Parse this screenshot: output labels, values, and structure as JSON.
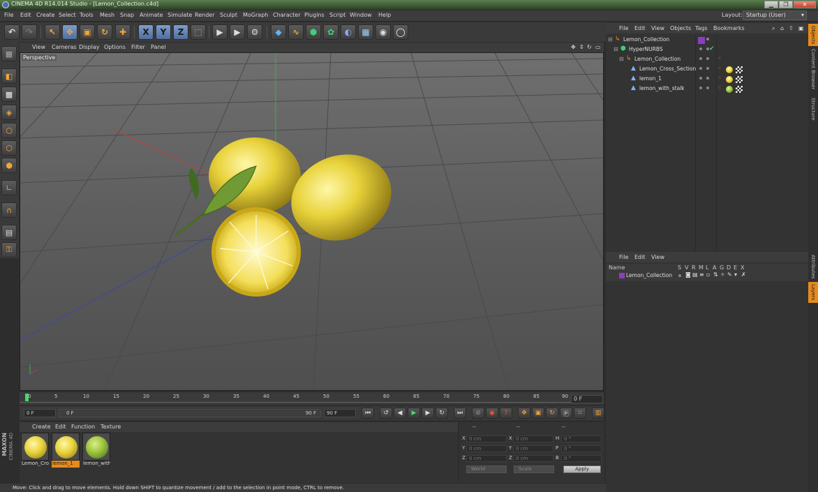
{
  "window": {
    "title": "CINEMA 4D R14.014 Studio - [Lemon_Collection.c4d]",
    "minimize": "▁",
    "maximize": "❐",
    "close": "✕"
  },
  "menubar": {
    "items": [
      "File",
      "Edit",
      "Create",
      "Select",
      "Tools",
      "Mesh",
      "Snap",
      "Animate",
      "Simulate",
      "Render",
      "Sculpt",
      "MoGraph",
      "Character",
      "Plugins",
      "Script",
      "Window",
      "Help"
    ],
    "layout_label": "Layout:",
    "layout_value": "Startup (User)"
  },
  "toolbar": {
    "icons": [
      "undo-icon",
      "redo-icon",
      "live-selection-icon",
      "move-icon",
      "scale-icon",
      "rotate-icon",
      "add-icon",
      "x-axis-icon",
      "y-axis-icon",
      "z-axis-icon",
      "coord-system-icon",
      "render-view-icon",
      "render-picture-viewer-icon",
      "render-settings-icon",
      "cube-icon",
      "spline-icon",
      "nurbs-icon",
      "array-icon",
      "deformer-icon",
      "floor-icon",
      "camera-icon",
      "light-icon"
    ],
    "x_label": "X",
    "y_label": "Y",
    "z_label": "Z"
  },
  "viewport": {
    "menu": [
      "View",
      "Cameras",
      "Display",
      "Options",
      "Filter",
      "Panel"
    ],
    "label": "Perspective"
  },
  "timeline": {
    "ticks": [
      "0",
      "5",
      "10",
      "15",
      "20",
      "25",
      "30",
      "35",
      "40",
      "45",
      "50",
      "55",
      "60",
      "65",
      "70",
      "75",
      "80",
      "85",
      "90"
    ],
    "current_frame": "0 F"
  },
  "transport": {
    "start_field": "0 F",
    "range_start": "0 F",
    "range_end": "90 F",
    "end_field": "90 F"
  },
  "materials": {
    "menu": [
      "Create",
      "Edit",
      "Function",
      "Texture"
    ],
    "items": [
      {
        "label": "Lemon_Cro",
        "selected": false
      },
      {
        "label": "lemon_1",
        "selected": true
      },
      {
        "label": "lemon_with",
        "selected": false
      }
    ]
  },
  "coordinates": {
    "header_left": "--",
    "header_mid": "--",
    "header_right": "--",
    "rows": [
      {
        "a": "X",
        "av": "0 cm",
        "b": "X",
        "bv": "0 cm",
        "c": "H",
        "cv": "0 °"
      },
      {
        "a": "Y",
        "av": "0 cm",
        "b": "Y",
        "bv": "0 cm",
        "c": "P",
        "cv": "0 °"
      },
      {
        "a": "Z",
        "av": "0 cm",
        "b": "Z",
        "bv": "0 cm",
        "c": "B",
        "cv": "0 °"
      }
    ],
    "world": "World",
    "scale": "Scale",
    "apply": "Apply"
  },
  "status": "Move: Click and drag to move elements. Hold down SHIFT to quantize movement / add to the selection in point mode, CTRL to remove.",
  "object_manager": {
    "menu": [
      "File",
      "Edit",
      "View",
      "Objects",
      "Tags",
      "Bookmarks"
    ],
    "rows": [
      {
        "name": "Lemon_Collection"
      },
      {
        "name": "HyperNURBS"
      },
      {
        "name": "Lemon_Collection"
      },
      {
        "name": "Lemon_Cross_Section"
      },
      {
        "name": "lemon_1"
      },
      {
        "name": "lemon_with_stalk"
      }
    ]
  },
  "layer_manager": {
    "menu": [
      "File",
      "Edit",
      "View"
    ],
    "header": {
      "name": "Name",
      "cols": [
        "S",
        "V",
        "R",
        "M",
        "L",
        "A",
        "G",
        "D",
        "E",
        "X"
      ]
    },
    "rows": [
      {
        "name": "Lemon_Collection"
      }
    ]
  },
  "side_tabs": [
    "Objects",
    "Content Browser",
    "Structure",
    "Attributes",
    "Layers"
  ],
  "brand": {
    "maxon": "MAXON",
    "cinema": "CINEMA 4D"
  },
  "colors": {
    "accent": "#e58b1c",
    "layer_color": "#8a3dc2",
    "lemon": "#e8d23a"
  }
}
